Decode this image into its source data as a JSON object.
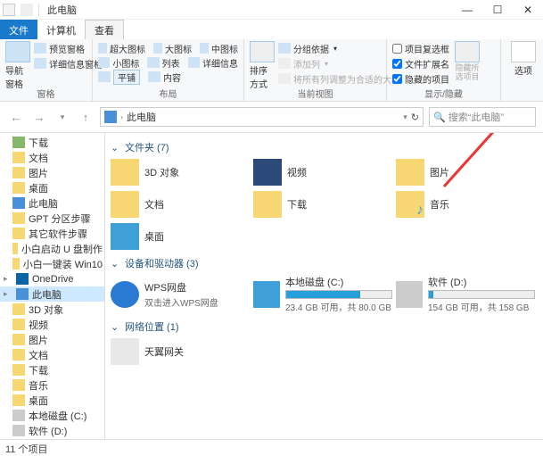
{
  "window": {
    "title": "此电脑",
    "minimize": "—",
    "maximize": "☐",
    "close": "✕"
  },
  "tabs": {
    "file": "文件",
    "computer": "计算机",
    "view": "查看"
  },
  "ribbon": {
    "panes": {
      "nav": "导航窗格",
      "preview": "预览窗格",
      "details": "详细信息窗格"
    },
    "panes_label": "窗格",
    "layout": {
      "xl": "超大图标",
      "lg": "大图标",
      "md": "中图标",
      "sm": "小图标",
      "list": "列表",
      "detail": "详细信息",
      "tiles": "平铺",
      "content": "内容"
    },
    "layout_label": "布局",
    "current": {
      "sort": "排序方式",
      "group": "分组依据",
      "addcol": "添加列",
      "autosize": "将所有列调整为合适的大小"
    },
    "current_label": "当前视图",
    "showhide": {
      "chk_item": "项目复选框",
      "chk_ext": "文件扩展名",
      "chk_hidden": "隐藏的项目",
      "hide": "隐藏所选项目"
    },
    "showhide_label": "显示/隐藏",
    "options": "选项"
  },
  "addr": {
    "back": "←",
    "fwd": "→",
    "up": "↑",
    "path": "此电脑",
    "search_ph": "搜索“此电脑”",
    "refresh": "↻"
  },
  "sidebar": [
    {
      "label": "下载",
      "cls": "dl",
      "lv": 1
    },
    {
      "label": "文档",
      "cls": "",
      "lv": 1
    },
    {
      "label": "图片",
      "cls": "",
      "lv": 1
    },
    {
      "label": "桌面",
      "cls": "",
      "lv": 1
    },
    {
      "label": "此电脑",
      "cls": "pc",
      "lv": 1
    },
    {
      "label": "GPT 分区步骤",
      "cls": "",
      "lv": 1
    },
    {
      "label": "其它软件步骤",
      "cls": "",
      "lv": 1
    },
    {
      "label": "小白启动 U 盘制作",
      "cls": "",
      "lv": 1
    },
    {
      "label": "小白一键装 Win10",
      "cls": "",
      "lv": 1
    },
    {
      "label": "OneDrive",
      "cls": "od",
      "lv": 0
    },
    {
      "label": "此电脑",
      "cls": "pc",
      "lv": 0,
      "sel": true
    },
    {
      "label": "3D 对象",
      "cls": "",
      "lv": 1
    },
    {
      "label": "视频",
      "cls": "",
      "lv": 1
    },
    {
      "label": "图片",
      "cls": "",
      "lv": 1
    },
    {
      "label": "文档",
      "cls": "",
      "lv": 1
    },
    {
      "label": "下载",
      "cls": "",
      "lv": 1
    },
    {
      "label": "音乐",
      "cls": "",
      "lv": 1
    },
    {
      "label": "桌面",
      "cls": "",
      "lv": 1
    },
    {
      "label": "本地磁盘 (C:)",
      "cls": "dr",
      "lv": 1
    },
    {
      "label": "软件 (D:)",
      "cls": "dr",
      "lv": 1
    }
  ],
  "sections": {
    "folders": {
      "title": "文件夹 (7)",
      "items": [
        {
          "label": "3D 对象",
          "cls": ""
        },
        {
          "label": "视频",
          "cls": "vid"
        },
        {
          "label": "图片",
          "cls": ""
        },
        {
          "label": "文档",
          "cls": ""
        },
        {
          "label": "下载",
          "cls": ""
        },
        {
          "label": "音乐",
          "cls": "music"
        },
        {
          "label": "桌面",
          "cls": "desk"
        }
      ]
    },
    "drives": {
      "title": "设备和驱动器 (3)",
      "items": [
        {
          "label": "WPS网盘",
          "sub": "双击进入WPS网盘",
          "cls": "wps"
        },
        {
          "label": "本地磁盘 (C:)",
          "sub": "23.4 GB 可用，共 80.0 GB",
          "cls": "driveC",
          "fill": 70
        },
        {
          "label": "软件 (D:)",
          "sub": "154 GB 可用，共 158 GB",
          "cls": "driveD",
          "fill": 4
        }
      ]
    },
    "netloc": {
      "title": "网络位置 (1)",
      "items": [
        {
          "label": "天翼网关",
          "cls": "net"
        }
      ]
    }
  },
  "status": {
    "count": "11 个项目"
  }
}
